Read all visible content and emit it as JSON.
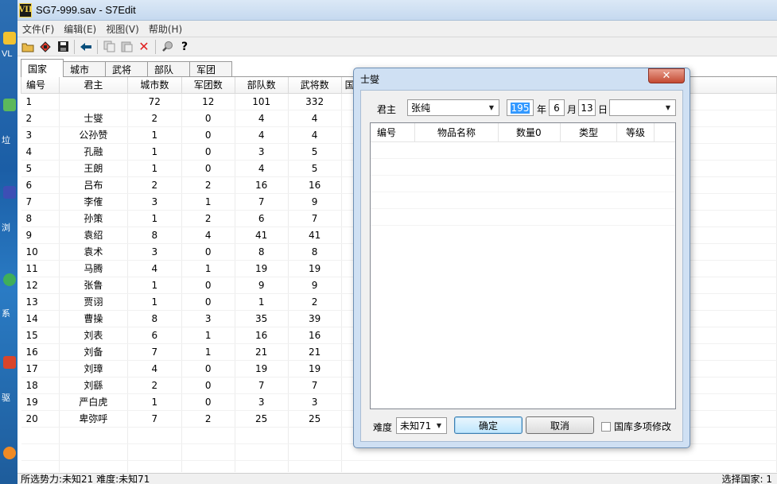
{
  "window": {
    "title": "SG7-999.sav - S7Edit",
    "icon_text": "VII"
  },
  "desktop": {
    "labels": [
      "VL",
      "垃",
      "浏",
      "系",
      "驱"
    ]
  },
  "menu": [
    "文件(F)",
    "编辑(E)",
    "视图(V)",
    "帮助(H)"
  ],
  "toolbar": {
    "icons": [
      "open-folder-icon",
      "tag-icon",
      "save-disk-icon",
      "back-arrow-icon",
      "copy-icon",
      "paste-icon",
      "delete-x-icon",
      "search-icon",
      "help-question-icon"
    ]
  },
  "tabs": [
    "国家",
    "城市",
    "武将",
    "部队",
    "军团"
  ],
  "table": {
    "headers": [
      "编号",
      "君主",
      "城市数",
      "军团数",
      "部队数",
      "武将数",
      "国"
    ],
    "rows": [
      [
        "1",
        "",
        "72",
        "12",
        "101",
        "332"
      ],
      [
        "2",
        "士燮",
        "2",
        "0",
        "4",
        "4"
      ],
      [
        "3",
        "公孙赞",
        "1",
        "0",
        "4",
        "4"
      ],
      [
        "4",
        "孔融",
        "1",
        "0",
        "3",
        "5"
      ],
      [
        "5",
        "王朗",
        "1",
        "0",
        "4",
        "5"
      ],
      [
        "6",
        "吕布",
        "2",
        "2",
        "16",
        "16"
      ],
      [
        "7",
        "李傕",
        "3",
        "1",
        "7",
        "9"
      ],
      [
        "8",
        "孙策",
        "1",
        "2",
        "6",
        "7"
      ],
      [
        "9",
        "袁绍",
        "8",
        "4",
        "41",
        "41"
      ],
      [
        "10",
        "袁术",
        "3",
        "0",
        "8",
        "8"
      ],
      [
        "11",
        "马腾",
        "4",
        "1",
        "19",
        "19"
      ],
      [
        "12",
        "张鲁",
        "1",
        "0",
        "9",
        "9"
      ],
      [
        "13",
        "贾诩",
        "1",
        "0",
        "1",
        "2"
      ],
      [
        "14",
        "曹操",
        "8",
        "3",
        "35",
        "39"
      ],
      [
        "15",
        "刘表",
        "6",
        "1",
        "16",
        "16"
      ],
      [
        "16",
        "刘备",
        "7",
        "1",
        "21",
        "21"
      ],
      [
        "17",
        "刘璋",
        "4",
        "0",
        "19",
        "19"
      ],
      [
        "18",
        "刘繇",
        "2",
        "0",
        "7",
        "7"
      ],
      [
        "19",
        "严白虎",
        "1",
        "0",
        "3",
        "3"
      ],
      [
        "20",
        "卑弥呼",
        "7",
        "2",
        "25",
        "25"
      ]
    ]
  },
  "status": {
    "left": "所选势力:未知21    难度:未知71",
    "right": "选择国家:  1"
  },
  "dialog": {
    "title": "士燮",
    "close": "✕",
    "lord_label": "君主",
    "lord_value": "张纯",
    "year_value": "195",
    "year_label": "年",
    "month_value": "6",
    "month_label": "月",
    "day_value": "13",
    "day_label": "日",
    "extra_value": "",
    "list_headers": [
      "编号",
      "物品名称",
      "数量0",
      "类型",
      "等级"
    ],
    "difficulty_label": "难度",
    "difficulty_value": "未知71",
    "ok": "确定",
    "cancel": "取消",
    "checkbox_label": "国库多项修改"
  }
}
